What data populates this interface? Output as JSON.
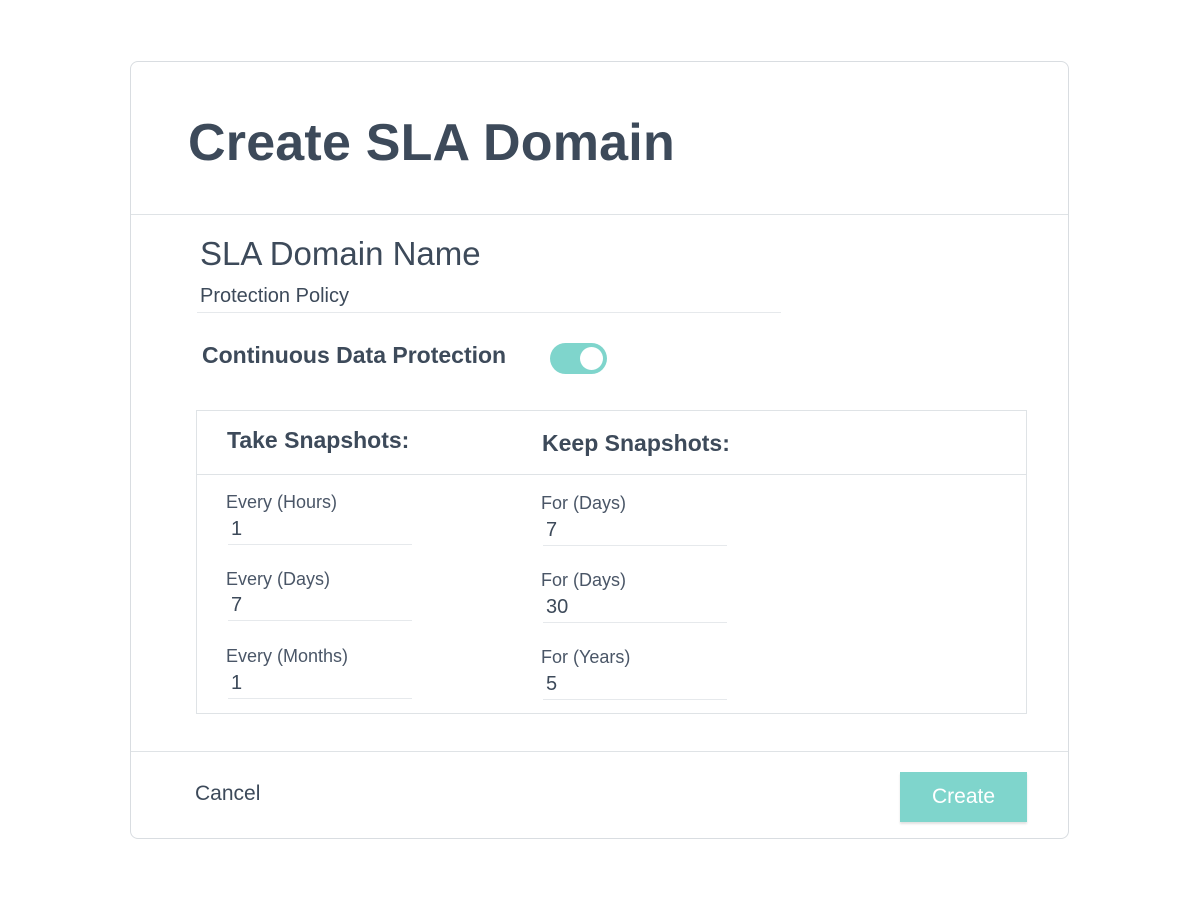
{
  "dialog": {
    "title": "Create SLA Domain",
    "name_label": "SLA Domain Name",
    "name_value": "Protection Policy",
    "cdp_label": "Continuous Data Protection",
    "cdp_enabled": true,
    "take_title": "Take Snapshots:",
    "keep_title": "Keep Snapshots:",
    "take": [
      {
        "label": "Every (Hours)",
        "value": "1"
      },
      {
        "label": "Every (Days)",
        "value": "7"
      },
      {
        "label": "Every (Months)",
        "value": "1"
      }
    ],
    "keep": [
      {
        "label": "For (Days)",
        "value": "7"
      },
      {
        "label": "For (Days)",
        "value": "30"
      },
      {
        "label": "For (Years)",
        "value": "5"
      }
    ],
    "cancel_label": "Cancel",
    "create_label": "Create"
  },
  "colors": {
    "accent": "#7fd5cc",
    "text": "#3d4a5a",
    "border": "#dfe3e6"
  }
}
